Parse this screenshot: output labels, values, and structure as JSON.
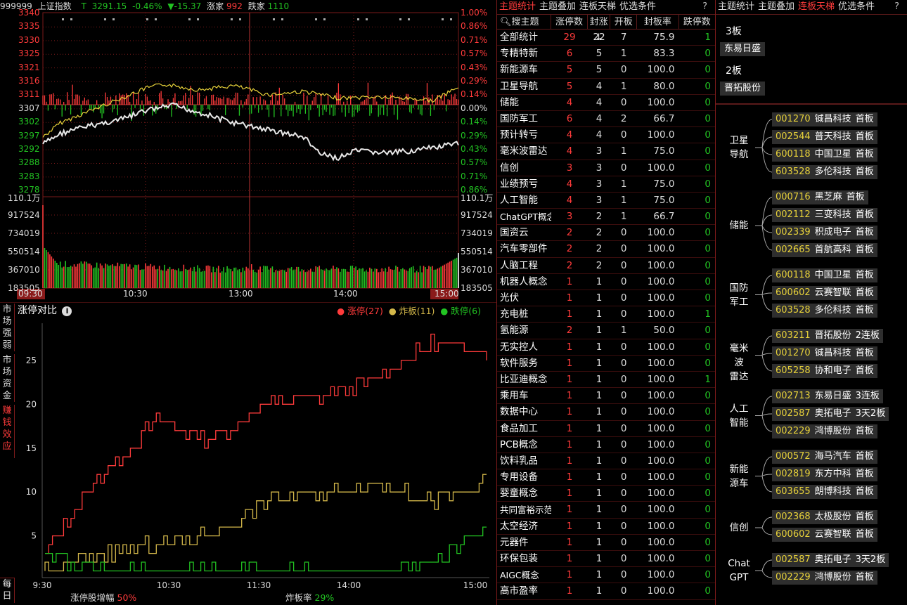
{
  "index_header": {
    "code": "999999",
    "name": "上证指数",
    "flag": "T",
    "price": "3291.15",
    "pct": "-0.46%",
    "arrow_change": "▼-15.37",
    "up_label": "涨家",
    "up_count": "992",
    "down_label": "跌家",
    "down_count": "1110"
  },
  "price_axis_left": [
    "3340",
    "3335",
    "3330",
    "3325",
    "3321",
    "3316",
    "3311",
    "3307",
    "3302",
    "3297",
    "3292",
    "3288",
    "3283",
    "3278"
  ],
  "price_axis_right": [
    "1.00%",
    "0.86%",
    "0.71%",
    "0.57%",
    "0.43%",
    "0.29%",
    "0.14%",
    "0.00%",
    "0.14%",
    "0.29%",
    "0.43%",
    "0.57%",
    "0.71%",
    "0.86%"
  ],
  "volume_axis": [
    "110.1万",
    "917524",
    "734019",
    "550514",
    "367010",
    "183505"
  ],
  "time_axis": [
    "09:30",
    "10:30",
    "13:00",
    "14:00",
    "15:00"
  ],
  "zt_panel": {
    "title": "涨停对比",
    "info_icon": "info-icon",
    "legend": [
      {
        "label": "涨停(27)",
        "color": "#ff3b3b"
      },
      {
        "label": "炸板(11)",
        "color": "#d4b84a"
      },
      {
        "label": "跌停(6)",
        "color": "#22c322"
      }
    ],
    "y_ticks": [
      "25",
      "20",
      "15",
      "10",
      "5"
    ],
    "x_ticks": [
      "9:30",
      "10:30",
      "11:30",
      "14:00",
      "15:00"
    ],
    "footer_left_label": "涨停股增幅",
    "footer_left_value": "50%",
    "footer_right_label": "炸板率",
    "footer_right_value": "29%",
    "side_tabs": [
      "市场强弱",
      "市场资金",
      "赚钱效应",
      "每日"
    ]
  },
  "chart_data": {
    "type": "line",
    "title": "涨停对比",
    "x": [
      "9:30",
      "10:30",
      "11:30",
      "14:00",
      "15:00"
    ],
    "ylim": [
      0,
      29
    ],
    "series": [
      {
        "name": "涨停",
        "values": [
          3,
          12,
          18,
          16,
          20,
          21,
          23,
          27,
          26
        ]
      },
      {
        "name": "炸板",
        "values": [
          1,
          3,
          4,
          5,
          9,
          10,
          11,
          9,
          11
        ]
      },
      {
        "name": "跌停",
        "values": [
          3,
          1,
          1,
          1,
          1,
          1,
          1,
          2,
          6
        ]
      }
    ]
  },
  "theme_table": {
    "tabs": [
      "主题统计",
      "主题叠加",
      "连板天梯",
      "优选条件"
    ],
    "active_tab": 0,
    "help": "?",
    "search_placeholder": "搜主题",
    "headers": [
      "涨停数",
      "封涨↓",
      "开板",
      "封板率",
      "跌停数"
    ],
    "total": {
      "name": "全部统计",
      "zt": "29",
      "fz": "22",
      "kb": "7",
      "rate": "75.9",
      "dt": "1"
    },
    "rows": [
      {
        "name": "专精特新",
        "zt": "6",
        "fz": "5",
        "kb": "1",
        "rate": "83.3",
        "dt": "0"
      },
      {
        "name": "新能源车",
        "zt": "5",
        "fz": "5",
        "kb": "0",
        "rate": "100.0",
        "dt": "0"
      },
      {
        "name": "卫星导航",
        "zt": "5",
        "fz": "4",
        "kb": "1",
        "rate": "80.0",
        "dt": "0"
      },
      {
        "name": "储能",
        "zt": "4",
        "fz": "4",
        "kb": "0",
        "rate": "100.0",
        "dt": "0"
      },
      {
        "name": "国防军工",
        "zt": "6",
        "fz": "4",
        "kb": "2",
        "rate": "66.7",
        "dt": "0"
      },
      {
        "name": "预计转亏",
        "zt": "4",
        "fz": "4",
        "kb": "0",
        "rate": "100.0",
        "dt": "0"
      },
      {
        "name": "毫米波雷达",
        "zt": "4",
        "fz": "3",
        "kb": "1",
        "rate": "75.0",
        "dt": "0"
      },
      {
        "name": "信创",
        "zt": "3",
        "fz": "3",
        "kb": "0",
        "rate": "100.0",
        "dt": "0"
      },
      {
        "name": "业绩预亏",
        "zt": "4",
        "fz": "3",
        "kb": "1",
        "rate": "75.0",
        "dt": "0"
      },
      {
        "name": "人工智能",
        "zt": "4",
        "fz": "3",
        "kb": "1",
        "rate": "75.0",
        "dt": "0"
      },
      {
        "name": "ChatGPT概念",
        "zt": "3",
        "fz": "2",
        "kb": "1",
        "rate": "66.7",
        "dt": "0"
      },
      {
        "name": "国资云",
        "zt": "2",
        "fz": "2",
        "kb": "0",
        "rate": "100.0",
        "dt": "0"
      },
      {
        "name": "汽车零部件",
        "zt": "2",
        "fz": "2",
        "kb": "0",
        "rate": "100.0",
        "dt": "0"
      },
      {
        "name": "人脑工程",
        "zt": "2",
        "fz": "2",
        "kb": "0",
        "rate": "100.0",
        "dt": "0"
      },
      {
        "name": "机器人概念",
        "zt": "1",
        "fz": "1",
        "kb": "0",
        "rate": "100.0",
        "dt": "0"
      },
      {
        "name": "光伏",
        "zt": "1",
        "fz": "1",
        "kb": "0",
        "rate": "100.0",
        "dt": "0"
      },
      {
        "name": "充电桩",
        "zt": "1",
        "fz": "1",
        "kb": "0",
        "rate": "100.0",
        "dt": "1"
      },
      {
        "name": "氢能源",
        "zt": "2",
        "fz": "1",
        "kb": "1",
        "rate": "50.0",
        "dt": "0"
      },
      {
        "name": "无实控人",
        "zt": "1",
        "fz": "1",
        "kb": "0",
        "rate": "100.0",
        "dt": "0"
      },
      {
        "name": "软件服务",
        "zt": "1",
        "fz": "1",
        "kb": "0",
        "rate": "100.0",
        "dt": "0"
      },
      {
        "name": "比亚迪概念",
        "zt": "1",
        "fz": "1",
        "kb": "0",
        "rate": "100.0",
        "dt": "1"
      },
      {
        "name": "乘用车",
        "zt": "1",
        "fz": "1",
        "kb": "0",
        "rate": "100.0",
        "dt": "0"
      },
      {
        "name": "数据中心",
        "zt": "1",
        "fz": "1",
        "kb": "0",
        "rate": "100.0",
        "dt": "0"
      },
      {
        "name": "食品加工",
        "zt": "1",
        "fz": "1",
        "kb": "0",
        "rate": "100.0",
        "dt": "0"
      },
      {
        "name": "PCB概念",
        "zt": "1",
        "fz": "1",
        "kb": "0",
        "rate": "100.0",
        "dt": "0"
      },
      {
        "name": "饮料乳品",
        "zt": "1",
        "fz": "1",
        "kb": "0",
        "rate": "100.0",
        "dt": "0"
      },
      {
        "name": "专用设备",
        "zt": "1",
        "fz": "1",
        "kb": "0",
        "rate": "100.0",
        "dt": "0"
      },
      {
        "name": "婴童概念",
        "zt": "1",
        "fz": "1",
        "kb": "0",
        "rate": "100.0",
        "dt": "0"
      },
      {
        "name": "共同富裕示范区",
        "zt": "1",
        "fz": "1",
        "kb": "0",
        "rate": "100.0",
        "dt": "0"
      },
      {
        "name": "太空经济",
        "zt": "1",
        "fz": "1",
        "kb": "0",
        "rate": "100.0",
        "dt": "0"
      },
      {
        "name": "元器件",
        "zt": "1",
        "fz": "1",
        "kb": "0",
        "rate": "100.0",
        "dt": "0"
      },
      {
        "name": "环保包装",
        "zt": "1",
        "fz": "1",
        "kb": "0",
        "rate": "100.0",
        "dt": "0"
      },
      {
        "name": "AIGC概念",
        "zt": "1",
        "fz": "1",
        "kb": "0",
        "rate": "100.0",
        "dt": "0"
      },
      {
        "name": "高市盈率",
        "zt": "1",
        "fz": "1",
        "kb": "0",
        "rate": "100.0",
        "dt": "0"
      }
    ]
  },
  "ladder": {
    "tabs": [
      "主题统计",
      "主题叠加",
      "连板天梯",
      "优选条件"
    ],
    "active_tab": 2,
    "help": "?",
    "boards": [
      {
        "title": "3板",
        "stock": "东易日盛"
      },
      {
        "title": "2板",
        "stock": "晋拓股份"
      }
    ],
    "groups": [
      {
        "label": "卫星导航",
        "stocks": [
          [
            "001270",
            "铖昌科技",
            "首板"
          ],
          [
            "002544",
            "普天科技",
            "首板"
          ],
          [
            "600118",
            "中国卫星",
            "首板"
          ],
          [
            "603528",
            "多伦科技",
            "首板"
          ]
        ]
      },
      {
        "label": "储能",
        "stocks": [
          [
            "000716",
            "黑芝麻",
            "首板"
          ],
          [
            "002112",
            "三变科技",
            "首板"
          ],
          [
            "002339",
            "积成电子",
            "首板"
          ],
          [
            "002665",
            "首航高科",
            "首板"
          ]
        ]
      },
      {
        "label": "国防军工",
        "stocks": [
          [
            "600118",
            "中国卫星",
            "首板"
          ],
          [
            "600602",
            "云赛智联",
            "首板"
          ],
          [
            "603528",
            "多伦科技",
            "首板"
          ]
        ]
      },
      {
        "label": "毫米波雷达",
        "stocks": [
          [
            "603211",
            "晋拓股份",
            "2连板"
          ],
          [
            "001270",
            "铖昌科技",
            "首板"
          ],
          [
            "605258",
            "协和电子",
            "首板"
          ]
        ]
      },
      {
        "label": "人工智能",
        "stocks": [
          [
            "002713",
            "东易日盛",
            "3连板"
          ],
          [
            "002587",
            "奥拓电子",
            "3天2板"
          ],
          [
            "002229",
            "鸿博股份",
            "首板"
          ]
        ]
      },
      {
        "label": "新能源车",
        "stocks": [
          [
            "000572",
            "海马汽车",
            "首板"
          ],
          [
            "002819",
            "东方中科",
            "首板"
          ],
          [
            "603655",
            "朗博科技",
            "首板"
          ]
        ]
      },
      {
        "label": "信创",
        "stocks": [
          [
            "002368",
            "太极股份",
            "首板"
          ],
          [
            "600602",
            "云赛智联",
            "首板"
          ]
        ]
      },
      {
        "label": "ChatGPT",
        "stocks": [
          [
            "002587",
            "奥拓电子",
            "3天2板"
          ],
          [
            "002229",
            "鸿博股份",
            "首板"
          ]
        ]
      }
    ]
  },
  "colors": {
    "up": "#ff3b3b",
    "down": "#22c322",
    "grid": "#7a1a1a",
    "index_line": "#e8e8e8",
    "avg_line": "#e8d23a"
  }
}
